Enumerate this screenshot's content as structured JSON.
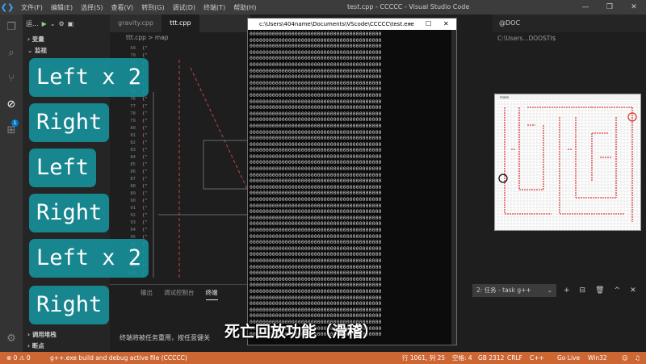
{
  "titlebar": {
    "menu": [
      "文件(F)",
      "编辑(E)",
      "选择(S)",
      "查看(V)",
      "转到(G)",
      "调试(D)",
      "终端(T)",
      "帮助(H)"
    ],
    "title": "test.cpp - CCCCC - Visual Studio Code",
    "controls": [
      "—",
      "❐",
      "✕"
    ]
  },
  "sidebar": {
    "toolbar_label": "运...",
    "sections": [
      {
        "label": "变量"
      },
      {
        "label": "监视"
      },
      {
        "label": "调用堆栈"
      },
      {
        "label": "断点"
      }
    ]
  },
  "editor": {
    "tabs": [
      "gravity.cpp",
      "ttt.cpp"
    ],
    "breadcrumb": "ttt.cpp > map",
    "line_numbers": [
      "69",
      "70",
      "71",
      "72",
      "73",
      "74",
      "75",
      "76",
      "77",
      "78",
      "79",
      "80",
      "81",
      "82",
      "83",
      "84",
      "85",
      "86",
      "87",
      "88",
      "89",
      "90",
      "91",
      "92",
      "93",
      "94",
      "95",
      "96",
      "97",
      "98",
      "99",
      "100"
    ],
    "code_token": "{\""
  },
  "panel": {
    "tabs": [
      "输出",
      "调试控制台",
      "终端"
    ],
    "active_tab": "终端",
    "terminal_text": "终端将被任务重用，按任意键关",
    "terminal_picker": "2: 任务 - task g++",
    "actions": [
      "+",
      "⊟",
      "🗑",
      "^",
      "✕"
    ]
  },
  "console": {
    "title": "c:\\Users\\404name\\Documents\\VScode\\CCCCC\\test.exe",
    "controls": [
      "—",
      "☐",
      "✕"
    ],
    "row_text": "00000000000000000000000000000000000000000",
    "row_count": 50
  },
  "right": {
    "header": "@DOC",
    "path": "C:\\Users...DOOSTI$"
  },
  "maze": {
    "title": "maze",
    "wall_color": "#e06060",
    "grid_color": "#c8c8c8"
  },
  "statusbar": {
    "errors": "⊗ 0 ⚠ 0",
    "task": "g++.exe build and debug active file (CCCCC)",
    "position": "行 1061, 列 25",
    "spaces": "空格: 4",
    "encoding": "GB 2312",
    "eol": "CRLF",
    "language": "C++",
    "golive": "Go Live",
    "platform": "Win32",
    "color": "#cc6633"
  },
  "overlays": {
    "buttons": [
      "Left x 2",
      "Right",
      "Left",
      "Right",
      "Left x 2",
      "Right"
    ],
    "color": "#16949e",
    "caption": "死亡回放功能（滑稽）"
  }
}
